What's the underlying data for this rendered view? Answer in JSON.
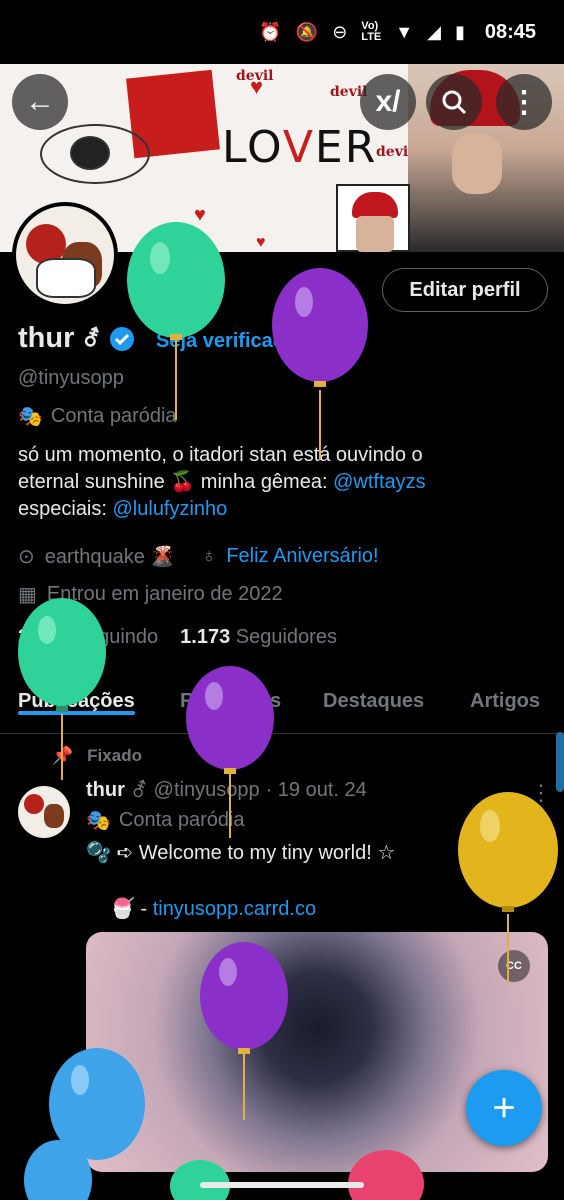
{
  "status_bar": {
    "time": "08:45",
    "icons": [
      "alarm-icon",
      "mute-icon",
      "dnd-icon",
      "volte-icon",
      "wifi-icon",
      "signal-icon",
      "battery-icon"
    ],
    "volte": "Vo)\nLTE"
  },
  "banner": {
    "lover_text_pre": "LO",
    "lover_text_v": "V",
    "lover_text_post": "ER",
    "devil_1": "devil",
    "devil_2": "devil",
    "devil_3": "devil"
  },
  "nav": {
    "back": "←",
    "grok": "x",
    "search": "⌕",
    "more": "⋮"
  },
  "profile": {
    "name": "thur",
    "verify_link": "Seja verificado",
    "handle": "@tinyusopp",
    "parody_label": "Conta paródia",
    "bio_line1": "só um momento, o itadori stan está ouvindo o",
    "bio_line2a": "eternal sunshine 🍒  minha gêmea: ",
    "bio_mention1": "@wtftayzs",
    "bio_line3a": "especiais: ",
    "bio_mention2": "@lulufyzinho",
    "location": "earthquake 🌋",
    "birthday": "Feliz Aniversário!",
    "joined": "Entrou em janeiro de 2022",
    "following_count": "2.049",
    "following_label": "Seguindo",
    "followers_count": "1.173",
    "followers_label": "Seguidores",
    "edit_button": "Editar perfil"
  },
  "tabs": [
    {
      "label": "Publicações",
      "active": true
    },
    {
      "label": "Respostas",
      "active": false
    },
    {
      "label": "Destaques",
      "active": false
    },
    {
      "label": "Artigos",
      "active": false
    }
  ],
  "pinned_post": {
    "pinned_label": "Fixado",
    "author": "thur",
    "handle": "@tinyusopp",
    "date": "· 19 out. 24",
    "parody_label": "Conta paródia",
    "text": "🫧 ➪ Welcome to my tiny world! ☆",
    "link_prefix": "🍧 -  ",
    "link": "tinyusopp.carrd.co",
    "cc_label": "CC"
  },
  "fab": {
    "label": "+"
  },
  "colors": {
    "accent": "#1d9bf0",
    "background": "#000000",
    "muted": "#71767b",
    "text": "#e7e9ea"
  },
  "balloons": [
    "green",
    "purple",
    "green",
    "purple",
    "yellow",
    "purple",
    "blue",
    "blue",
    "pink",
    "green"
  ]
}
